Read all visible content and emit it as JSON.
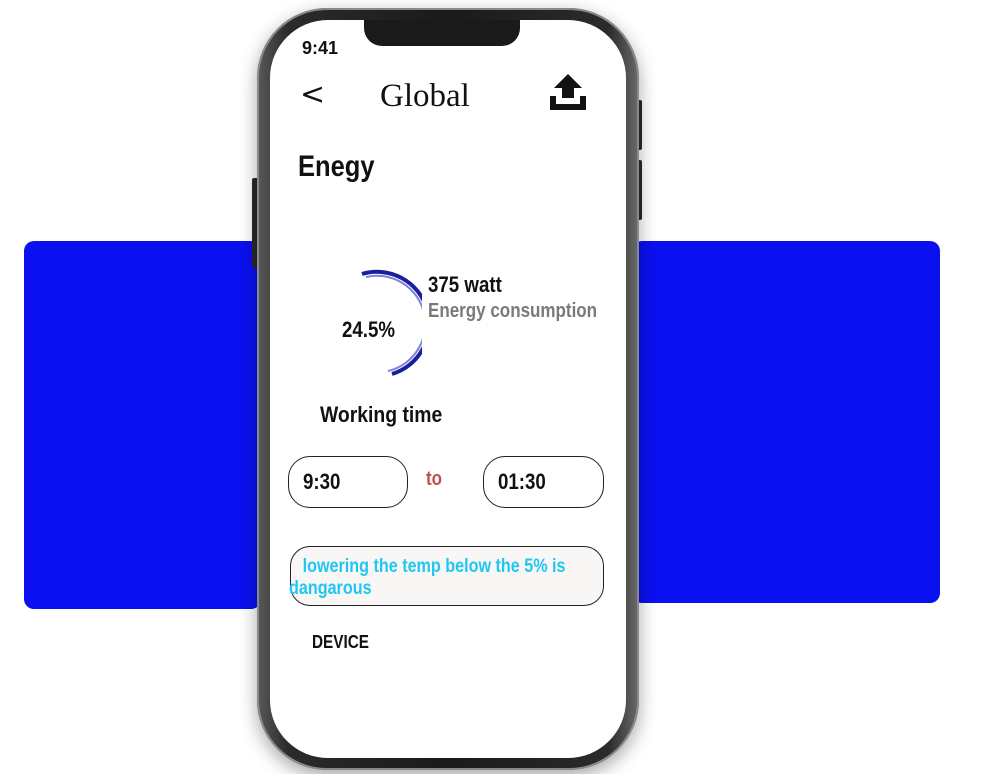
{
  "status_bar": {
    "time": "9:41"
  },
  "nav": {
    "back_label": "<",
    "title": "Global",
    "upload_icon": "upload-icon"
  },
  "section": {
    "title": "Enegy"
  },
  "energy": {
    "percent_label": "24.5%",
    "percent_value": 24.5,
    "watt_label": "375 watt",
    "consumption_label": "Energy consumption"
  },
  "working_time": {
    "label": "Working  time",
    "start": "9:30",
    "separator": "to",
    "end": "01:30"
  },
  "warning": {
    "text": "lowering the temp below the 5% is dangarous"
  },
  "device": {
    "label": "DEVICE"
  },
  "colors": {
    "side_panels": "#0a10f0",
    "gauge_arc": "#1a1f9e",
    "warning_text": "#1ec8f0",
    "to_text": "#c0504d",
    "secondary_text": "#7a7a7a"
  }
}
